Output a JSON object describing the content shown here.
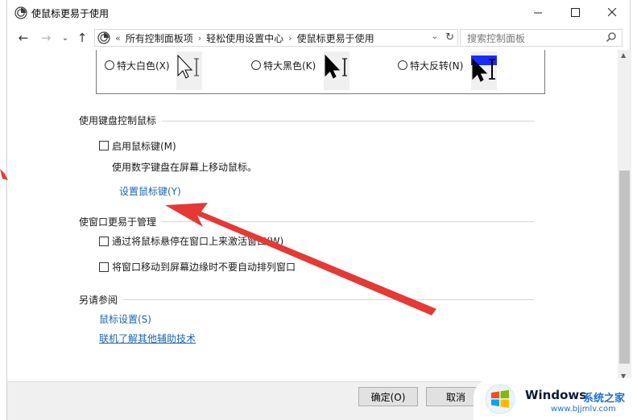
{
  "window": {
    "title": "使鼠标更易于使用"
  },
  "address_bar": {
    "overflow": "«",
    "crumbs": [
      "所有控制面板项",
      "轻松使用设置中心",
      "使鼠标更易于使用"
    ]
  },
  "search": {
    "placeholder": "搜索控制面板"
  },
  "cursor_schemes": [
    {
      "label": "特大白色(X)"
    },
    {
      "label": "特大黑色(K)"
    },
    {
      "label": "特大反转(N)"
    }
  ],
  "keyboard_section": {
    "title": "使用键盘控制鼠标",
    "checkbox_label": "启用鼠标键(M)",
    "description": "使用数字键盘在屏幕上移动鼠标。",
    "link": "设置鼠标键(Y)"
  },
  "window_section": {
    "title": "使窗口更易于管理",
    "option1": "通过将鼠标悬停在窗口上来激活窗口(W)",
    "option2": "将窗口移动到屏幕边缘时不要自动排列窗口"
  },
  "see_also": {
    "title": "另请参阅",
    "link1": "鼠标设置(S)",
    "link2": "联机了解其他辅助技术"
  },
  "buttons": {
    "ok": "确定(O)",
    "cancel": "取消"
  },
  "watermark": {
    "brand": "Windows",
    "cn": "系统之家",
    "url": "www.bjjmlv.com"
  },
  "colors": {
    "link": "#1e63b3",
    "annotation_arrow": "#e53935",
    "accent_blue": "#1f6fd0"
  }
}
